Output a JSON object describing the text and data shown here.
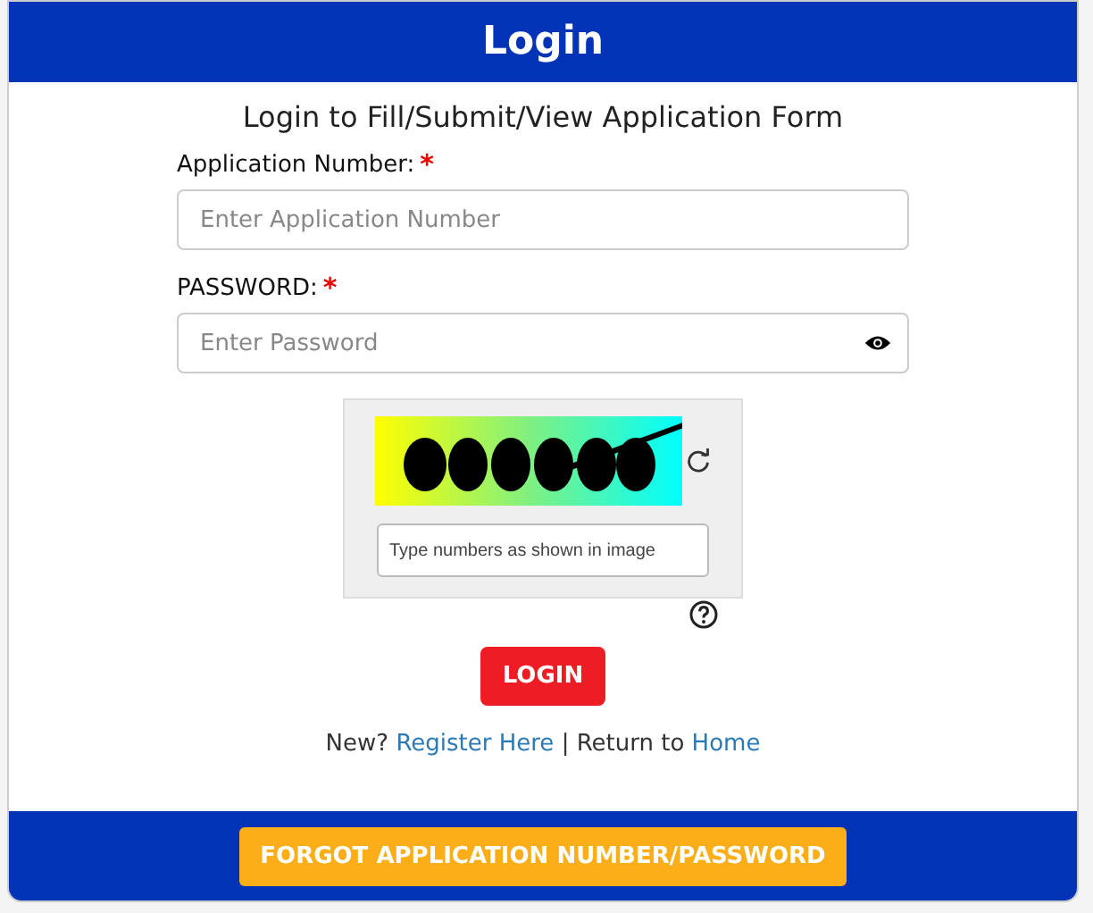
{
  "header": {
    "title": "Login"
  },
  "subtitle": "Login to Fill/Submit/View Application Form",
  "fields": [
    {
      "label": "Application Number:",
      "required_mark": "*",
      "placeholder": "Enter Application Number",
      "kind": "text"
    },
    {
      "label": "PASSWORD:",
      "required_mark": "*",
      "placeholder": "Enter Password",
      "kind": "password"
    }
  ],
  "captcha": {
    "placeholder": "Type numbers as shown in image"
  },
  "login_button": "LOGIN",
  "links": {
    "new_prefix": "New?",
    "register": "Register Here",
    "separator": "|",
    "return_prefix": "Return to",
    "home": "Home"
  },
  "footer": {
    "button": "FORGOT APPLICATION NUMBER/PASSWORD"
  }
}
